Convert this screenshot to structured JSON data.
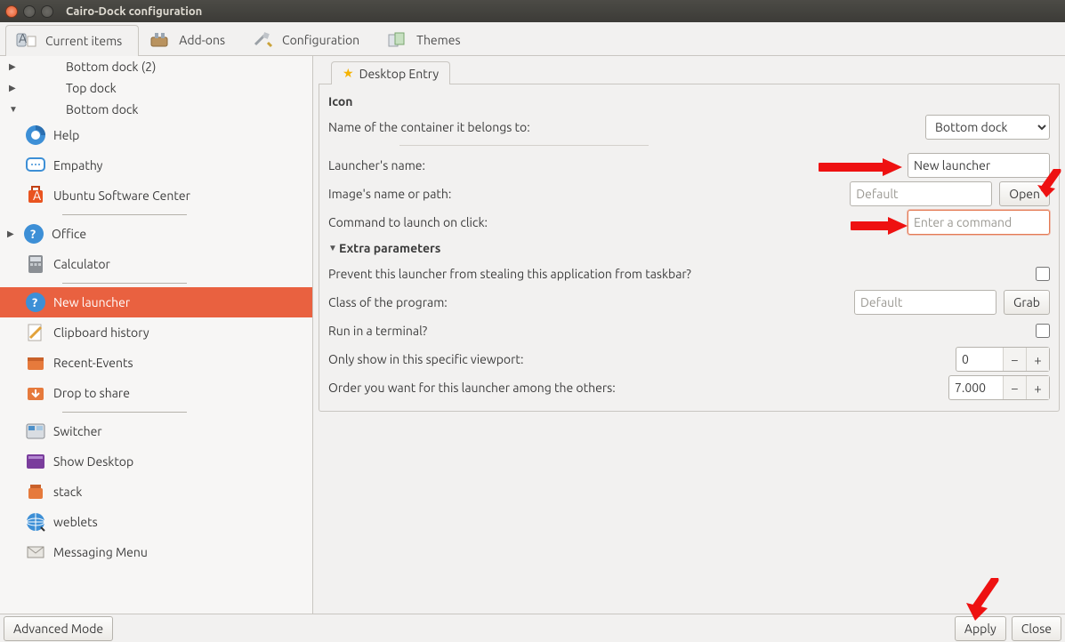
{
  "window": {
    "title": "Cairo-Dock configuration"
  },
  "toptabs": {
    "current_items": "Current items",
    "addons": "Add-ons",
    "configuration": "Configuration",
    "themes": "Themes"
  },
  "sidebar": {
    "docks": {
      "bottom_dock_2": "Bottom dock (2)",
      "top_dock": "Top dock",
      "bottom_dock": "Bottom dock"
    },
    "items": {
      "help": "Help",
      "empathy": "Empathy",
      "ubuntu_software_center": "Ubuntu Software Center",
      "office": "Office",
      "calculator": "Calculator",
      "new_launcher": "New launcher",
      "clipboard_history": "Clipboard history",
      "recent_events": "Recent-Events",
      "drop_to_share": "Drop to share",
      "switcher": "Switcher",
      "show_desktop": "Show Desktop",
      "stack": "stack",
      "weblets": "weblets",
      "messaging_menu": "Messaging Menu"
    }
  },
  "content": {
    "tab": "Desktop Entry",
    "icon_section": "Icon",
    "container_label": "Name of the container it belongs to:",
    "container_value": "Bottom dock",
    "launcher_name_label": "Launcher's name:",
    "launcher_name_value": "New launcher",
    "image_label": "Image's name or path:",
    "image_placeholder": "Default",
    "open_btn": "Open",
    "command_label": "Command to launch on click:",
    "command_placeholder": "Enter a command",
    "extra_section": "Extra parameters",
    "prevent_label": "Prevent this launcher from stealing this application from taskbar?",
    "class_label": "Class of the program:",
    "class_placeholder": "Default",
    "grab_btn": "Grab",
    "terminal_label": "Run in a terminal?",
    "viewport_label": "Only show in this specific viewport:",
    "viewport_value": "0",
    "order_label": "Order you want for this launcher among the others:",
    "order_value": "7.000"
  },
  "footer": {
    "advanced": "Advanced Mode",
    "apply": "Apply",
    "close": "Close"
  }
}
